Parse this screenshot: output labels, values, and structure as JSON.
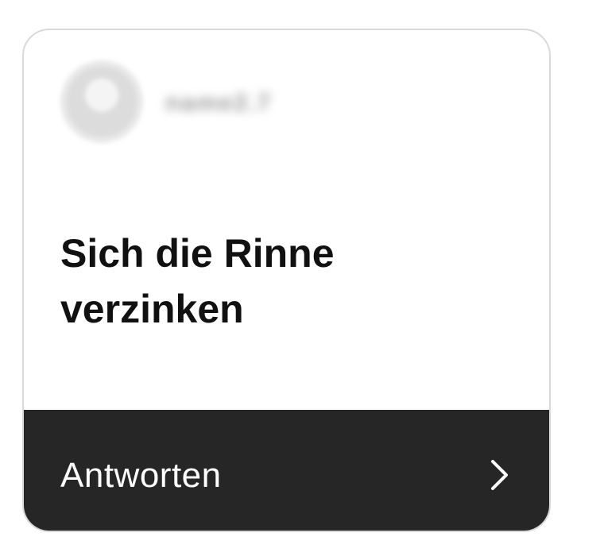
{
  "card": {
    "username": "name2.7",
    "title": "Sich die Rinne verzinken",
    "action_label": "Antworten",
    "action_icon": "chevron-right-icon"
  },
  "colors": {
    "footer_background": "#262626",
    "title_text": "#111111",
    "footer_text": "#ffffff",
    "card_border": "#d9d9d9"
  }
}
